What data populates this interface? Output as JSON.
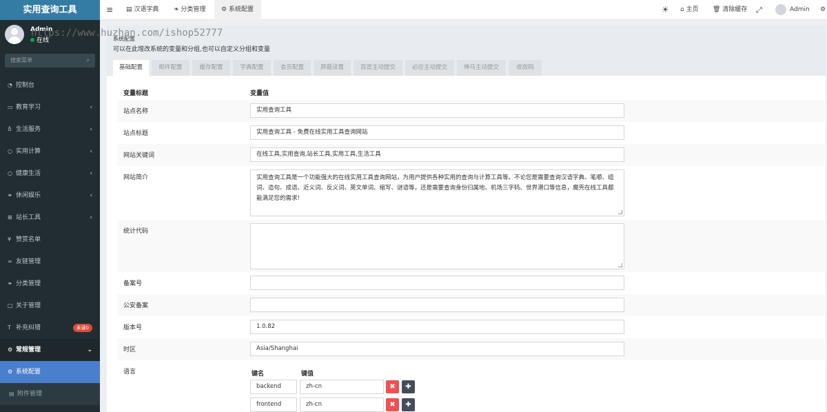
{
  "app": {
    "title": "实用查询工具"
  },
  "user": {
    "name": "Admin",
    "status": "在线"
  },
  "watermark": "https://www.huzhan.com/ishop52777",
  "search": {
    "placeholder": "搜索菜单"
  },
  "menu": [
    {
      "label": "控制台",
      "icon": "dashboard-icon",
      "arrow": ""
    },
    {
      "label": "教育学习",
      "icon": "monitor-icon",
      "arrow": "‹"
    },
    {
      "label": "生活服务",
      "icon": "flask-icon",
      "arrow": "‹"
    },
    {
      "label": "实用计算",
      "icon": "circle-icon",
      "arrow": "‹"
    },
    {
      "label": "健康生活",
      "icon": "circle-icon",
      "arrow": "‹"
    },
    {
      "label": "休闲娱乐",
      "icon": "leaf-icon",
      "arrow": "‹"
    },
    {
      "label": "站长工具",
      "icon": "sitemap-icon",
      "arrow": "‹"
    },
    {
      "label": "赞赏名单",
      "icon": "yen-icon",
      "arrow": ""
    },
    {
      "label": "友链管理",
      "icon": "link-icon",
      "arrow": ""
    },
    {
      "label": "分类管理",
      "icon": "leaf-icon",
      "arrow": ""
    },
    {
      "label": "关于管理",
      "icon": "square-icon",
      "arrow": ""
    },
    {
      "label": "补充纠错",
      "icon": "text-icon",
      "arrow": "",
      "badge": "未读0"
    },
    {
      "label": "常规管理",
      "icon": "cogs-icon",
      "arrow": "⌄"
    },
    {
      "label": "系统配置",
      "icon": "gear-icon",
      "arrow": ""
    },
    {
      "label": "附件管理",
      "icon": "file-icon",
      "arrow": ""
    }
  ],
  "topbar": {
    "tabs": [
      "汉语字典",
      "分类管理",
      "系统配置"
    ],
    "home": "主页",
    "clear_cache": "清除缓存",
    "admin": "Admin"
  },
  "page": {
    "title": "系统配置",
    "subtitle": "可以在此增改系统的变量和分组,也可以自定义分组和变量",
    "tabs": [
      "基础配置",
      "邮件配置",
      "缓存配置",
      "字典配置",
      "会员配置",
      "屏蔽设置",
      "百度主动提交",
      "必应主动提交",
      "神马主动提交",
      "收款码"
    ]
  },
  "table": {
    "col_name": "变量标题",
    "col_value": "变量值",
    "rows": {
      "site_name": {
        "label": "站点名称",
        "value": "实用查询工具"
      },
      "site_title": {
        "label": "站点标题",
        "value": "实用查询工具 - 免费在线实用工具查询网站"
      },
      "keywords": {
        "label": "网站关键词",
        "value": "在线工具,实用查询,站长工具,实用工具,生活工具"
      },
      "intro": {
        "label": "网站简介",
        "value": "实用查询工具是一个功能强大的在线实用工具查询网站，为用户提供各种实用的查询与计算工具等。不论您是需要查询汉语字典、笔顺、组词、造句、成语、近义词、反义词、英文单词、缩写、谜语等，还是需要查询身份归属地、机场三字码、世界港口等信息，魔壳在线工具都能满足您的需求!"
      },
      "stat_code": {
        "label": "统计代码",
        "value": ""
      },
      "beian": {
        "label": "备案号",
        "value": ""
      },
      "police_beian": {
        "label": "公安备案",
        "value": ""
      },
      "version": {
        "label": "版本号",
        "value": "1.0.82"
      },
      "timezone": {
        "label": "时区",
        "value": "Asia/Shanghai"
      },
      "language": {
        "label": "语言",
        "key_header": "键名",
        "value_header": "键值",
        "pairs": [
          {
            "key": "backend",
            "value": "zh-cn"
          },
          {
            "key": "frontend",
            "value": "zh-cn"
          }
        ]
      }
    }
  }
}
